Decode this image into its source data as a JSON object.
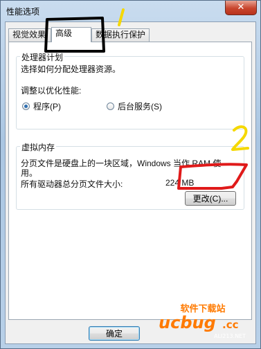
{
  "window": {
    "title": "性能选项",
    "close_glyph": "✕"
  },
  "tabs": [
    {
      "label": "视觉效果"
    },
    {
      "label": "高级"
    },
    {
      "label": "数据执行保护"
    }
  ],
  "processor": {
    "group_title": "处理器计划",
    "description": "选择如何分配处理器资源。",
    "adjust_label": "调整以优化性能:",
    "option_programs": "程序(P)",
    "option_services": "后台服务(S)",
    "selected": "option_programs"
  },
  "virtual_memory": {
    "group_title": "虚拟内存",
    "description_line1": "分页文件是硬盘上的一块区域，Windows 当作 RAM 使",
    "description_line2": "用。",
    "total_label": "所有驱动器总分页文件大小:",
    "total_value": "224 MB",
    "change_button": "更改(C)..."
  },
  "footer": {
    "ok_button": "确定"
  },
  "annotations": {
    "one": "1",
    "two": "2"
  },
  "watermark": {
    "brand": "ucbug",
    "suffix": ".cc",
    "tagline": "软件下载站",
    "site": "ALI213.NET"
  },
  "colors": {
    "annotation_yellow": "#f5d800",
    "annotation_red": "#e01a1a",
    "annotation_black": "#000000"
  }
}
